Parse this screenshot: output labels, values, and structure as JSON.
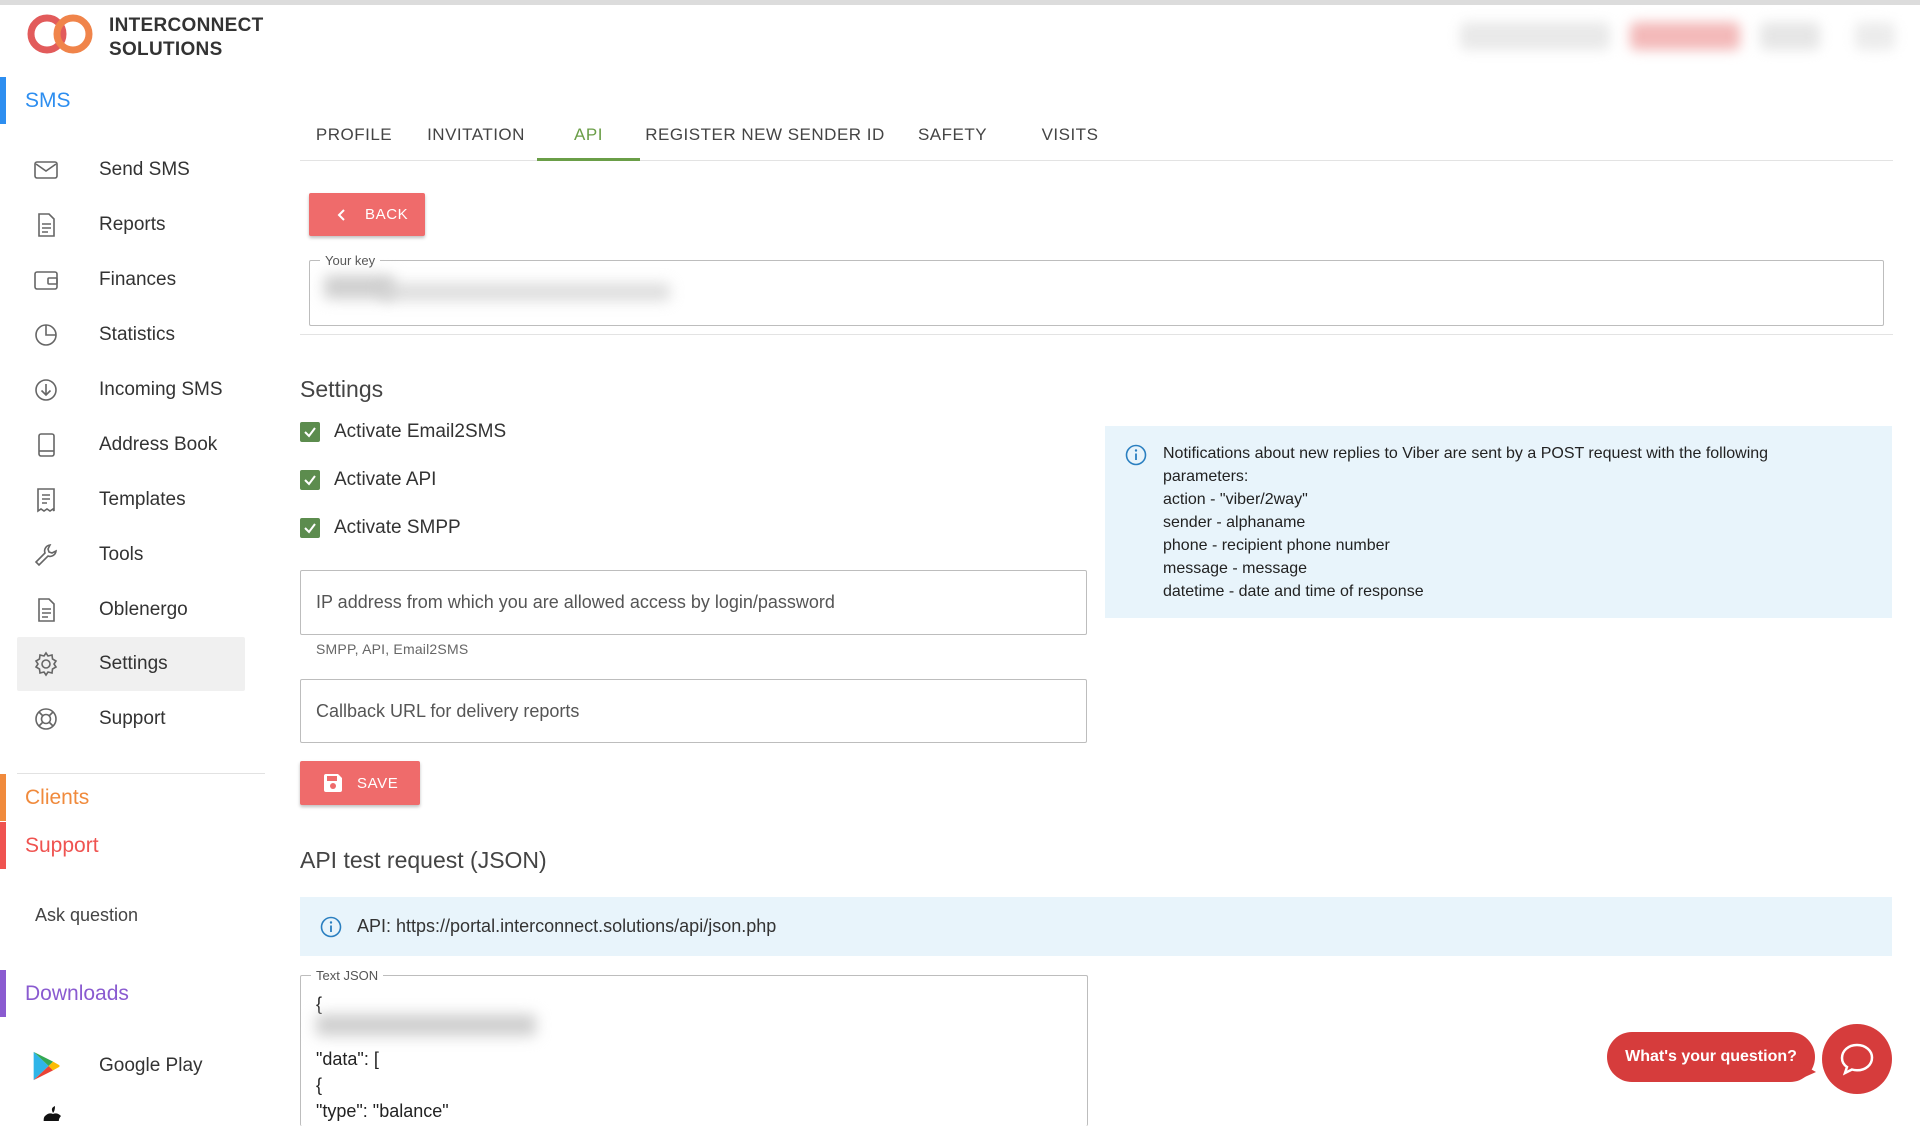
{
  "brand": {
    "name_line1": "INTERCONNECT",
    "name_line2": "SOLUTIONS",
    "accent": "#ef6b6b"
  },
  "sidebar": {
    "sections": [
      {
        "label": "SMS",
        "color": "#2d8ef0"
      },
      {
        "label": "Clients",
        "color": "#f08a3c"
      },
      {
        "label": "Support",
        "color": "#ef5350"
      },
      {
        "label": "Downloads",
        "color": "#8a5bd0"
      }
    ],
    "items": [
      {
        "label": "Send SMS",
        "icon": "mail-icon"
      },
      {
        "label": "Reports",
        "icon": "document-icon"
      },
      {
        "label": "Finances",
        "icon": "wallet-icon"
      },
      {
        "label": "Statistics",
        "icon": "pie-chart-icon"
      },
      {
        "label": "Incoming SMS",
        "icon": "download-circle-icon"
      },
      {
        "label": "Address Book",
        "icon": "book-icon"
      },
      {
        "label": "Templates",
        "icon": "receipt-icon"
      },
      {
        "label": "Tools",
        "icon": "wrench-icon"
      },
      {
        "label": "Oblenergo",
        "icon": "document-icon"
      },
      {
        "label": "Settings",
        "icon": "gear-icon",
        "active": true
      },
      {
        "label": "Support",
        "icon": "lifebuoy-icon"
      }
    ],
    "ask_question": "Ask question",
    "downloads": [
      {
        "label": "Google Play",
        "icon": "google-play-icon"
      }
    ]
  },
  "tabs": [
    {
      "label": "PROFILE"
    },
    {
      "label": "INVITATION"
    },
    {
      "label": "API",
      "active": true
    },
    {
      "label": "REGISTER NEW SENDER ID"
    },
    {
      "label": "SAFETY"
    },
    {
      "label": "VISITS"
    }
  ],
  "back_button": "BACK",
  "key_field": {
    "legend": "Your key"
  },
  "settings": {
    "title": "Settings",
    "checkboxes": [
      {
        "label": "Activate Email2SMS",
        "checked": true
      },
      {
        "label": "Activate API",
        "checked": true
      },
      {
        "label": "Activate SMPP",
        "checked": true
      }
    ],
    "ip_placeholder": "IP address from which you are allowed access by login/password",
    "ip_hint": "SMPP, API, Email2SMS",
    "callback_placeholder": "Callback URL for delivery reports",
    "save_label": "SAVE"
  },
  "viber_info": {
    "lines": [
      "Notifications about new replies to Viber are sent by a POST request with the following",
      "parameters:",
      "action - \"viber/2way\"",
      "sender - alphaname",
      "phone - recipient phone number",
      "message - message",
      "datetime - date and time of response"
    ]
  },
  "api_test": {
    "title": "API test request (JSON)",
    "url_info": "API: https://portal.interconnect.solutions/api/json.php",
    "legend": "Text JSON",
    "json_lines": [
      "{",
      "\"data\": [",
      "{",
      "\"type\": \"balance\""
    ]
  },
  "chat": {
    "question": "What's your question?"
  }
}
